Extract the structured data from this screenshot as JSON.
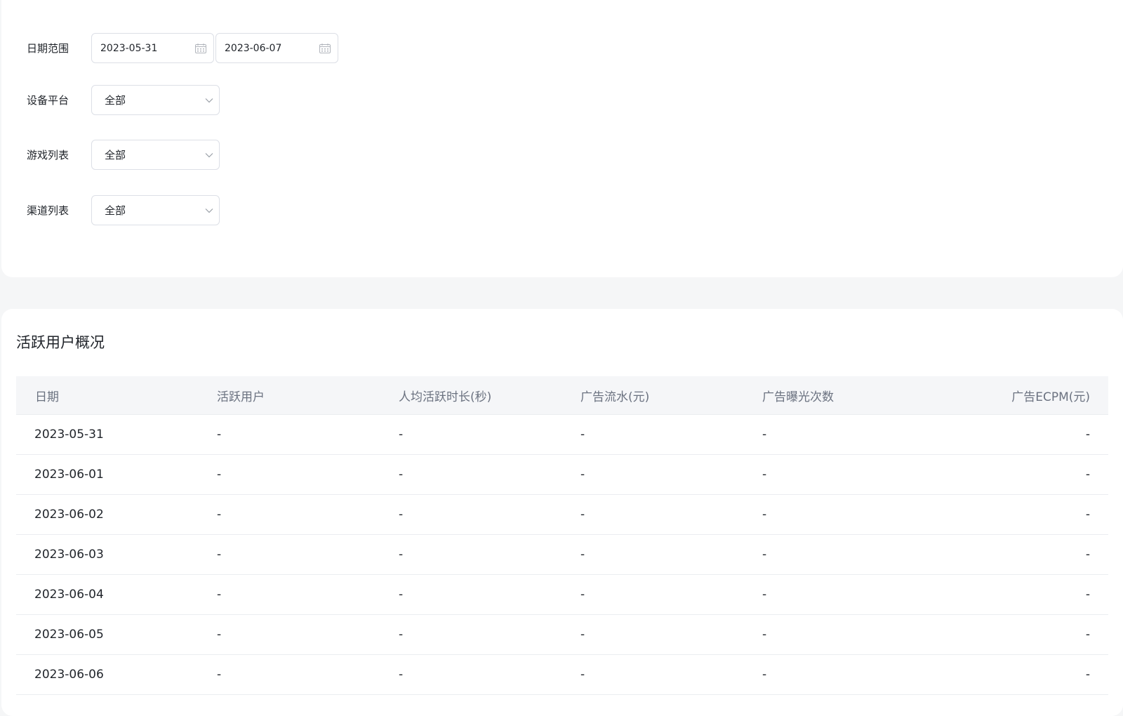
{
  "filters": {
    "date_range": {
      "label": "日期范围",
      "start": "2023-05-31",
      "end": "2023-06-07"
    },
    "platform": {
      "label": "设备平台",
      "value": "全部"
    },
    "games": {
      "label": "游戏列表",
      "value": "全部"
    },
    "channels": {
      "label": "渠道列表",
      "value": "全部"
    }
  },
  "section": {
    "title": "活跃用户概况"
  },
  "table": {
    "columns": [
      "日期",
      "活跃用户",
      "人均活跃时长(秒)",
      "广告流水(元)",
      "广告曝光次数",
      "广告ECPM(元)"
    ],
    "rows": [
      [
        "2023-05-31",
        "-",
        "-",
        "-",
        "-",
        "-"
      ],
      [
        "2023-06-01",
        "-",
        "-",
        "-",
        "-",
        "-"
      ],
      [
        "2023-06-02",
        "-",
        "-",
        "-",
        "-",
        "-"
      ],
      [
        "2023-06-03",
        "-",
        "-",
        "-",
        "-",
        "-"
      ],
      [
        "2023-06-04",
        "-",
        "-",
        "-",
        "-",
        "-"
      ],
      [
        "2023-06-05",
        "-",
        "-",
        "-",
        "-",
        "-"
      ],
      [
        "2023-06-06",
        "-",
        "-",
        "-",
        "-",
        "-"
      ]
    ]
  },
  "icons": {
    "date_picker": "calendar-icon",
    "select": "chevron-down-icon"
  },
  "colors": {
    "background": "#f5f6f7",
    "card": "#ffffff",
    "header_bg": "#f5f6f8",
    "border": "#dcdfe6"
  }
}
